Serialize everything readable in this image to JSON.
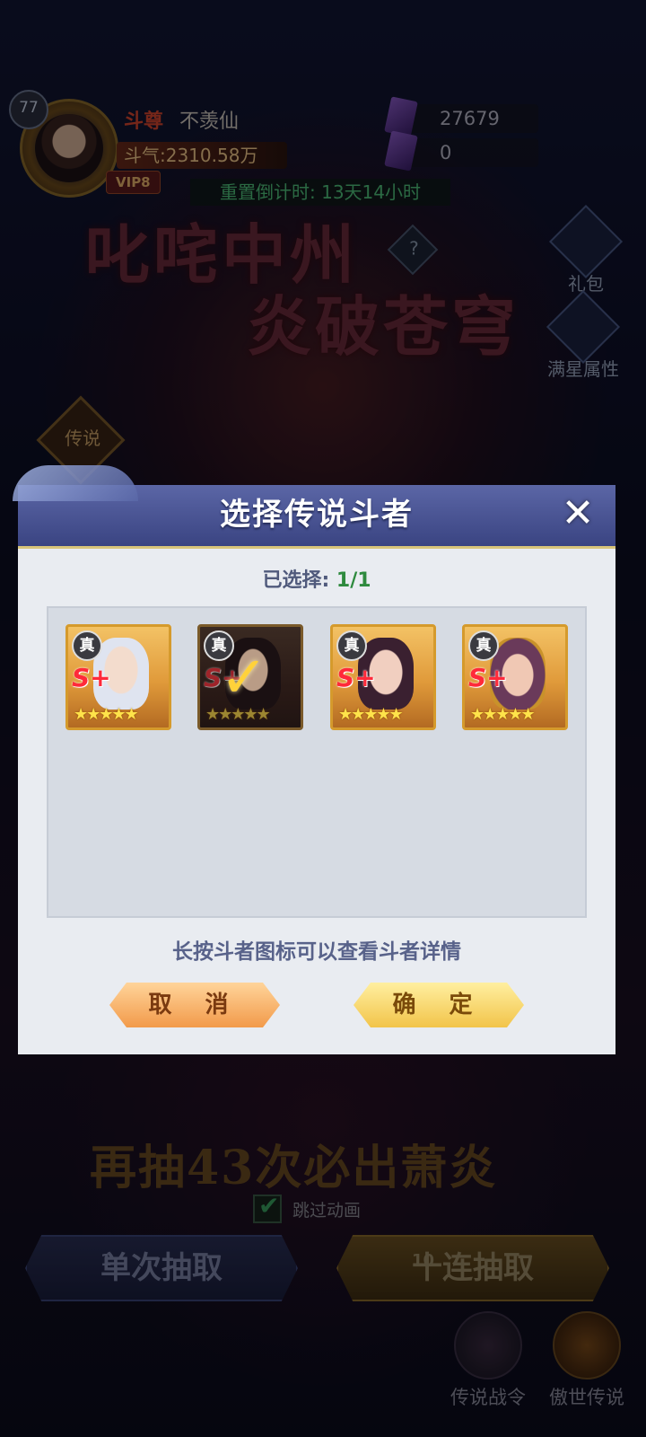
{
  "player": {
    "level": "77",
    "rank": "斗尊",
    "name": "不羡仙",
    "power": "斗气:2310.58万",
    "vip": "VIP8"
  },
  "resources": [
    {
      "value": "27679",
      "icon": "purple-gem-icon"
    },
    {
      "value": "0",
      "icon": "purple-ticket-icon"
    }
  ],
  "countdown": "重置倒计时: 13天14小时",
  "banner": {
    "line1": "叱咤中州",
    "line2": "炎破苍穹"
  },
  "side_buttons": {
    "gift": "礼包",
    "star_attr": "满星属性",
    "legend": "传说"
  },
  "bottom": {
    "pity_text": "再抽43次必出萧炎",
    "skip_animation": "跳过动画",
    "draw_single": "单次抽取",
    "draw_single_count": "1",
    "draw_ten": "十连抽取",
    "draw_ten_count": "10",
    "nav": [
      "传说战令",
      "傲世传说"
    ]
  },
  "dialog": {
    "title": "选择传说斗者",
    "selected_label": "已选择: ",
    "selected_value": "1/1",
    "hint": "长按斗者图标可以查看斗者详情",
    "cancel": "取 消",
    "confirm": "确 定",
    "cards": [
      {
        "tag": "真",
        "grade": "S+",
        "stars": "★★★★★",
        "selected": false
      },
      {
        "tag": "真",
        "grade": "S+",
        "stars": "★★★★★",
        "selected": true
      },
      {
        "tag": "真",
        "grade": "S+",
        "stars": "★★★★★",
        "selected": false
      },
      {
        "tag": "真",
        "grade": "S+",
        "stars": "★★★★★",
        "selected": false
      }
    ]
  },
  "colors": {
    "selected_count": "#2e8a3e",
    "header": "#4a55a0",
    "grade": "#ff2a3a"
  }
}
